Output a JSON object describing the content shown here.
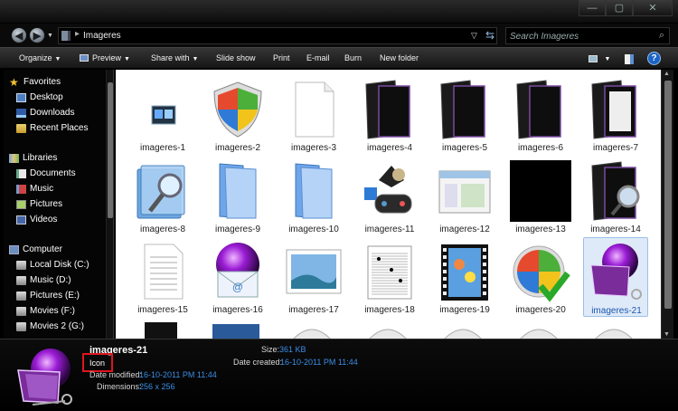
{
  "window": {
    "minimize": "—",
    "maximize": "▢",
    "close": "✕"
  },
  "address": {
    "folder": "Imageres",
    "separator": "▸",
    "search_placeholder": "Search Imageres"
  },
  "toolbar": {
    "organize": "Organize",
    "preview": "Preview",
    "share_with": "Share with",
    "slide_show": "Slide show",
    "print": "Print",
    "email": "E-mail",
    "burn": "Burn",
    "new_folder": "New folder",
    "help": "?"
  },
  "nav": {
    "favorites": {
      "label": "Favorites",
      "items": [
        "Desktop",
        "Downloads",
        "Recent Places"
      ]
    },
    "libraries": {
      "label": "Libraries",
      "items": [
        "Documents",
        "Music",
        "Pictures",
        "Videos"
      ]
    },
    "computer": {
      "label": "Computer",
      "items": [
        "Local Disk (C:)",
        "Music (D:)",
        "Pictures (E:)",
        "Movies (F:)",
        "Movies 2 (G:)"
      ]
    }
  },
  "files": [
    {
      "name": "imageres-1",
      "icon": "window-shot-icon"
    },
    {
      "name": "imageres-2",
      "icon": "shield-icon"
    },
    {
      "name": "imageres-3",
      "icon": "blank-page-icon"
    },
    {
      "name": "imageres-4",
      "icon": "dark-folder-icon"
    },
    {
      "name": "imageres-5",
      "icon": "dark-folder-icon"
    },
    {
      "name": "imageres-6",
      "icon": "dark-folder-icon"
    },
    {
      "name": "imageres-7",
      "icon": "dark-folder-page-icon"
    },
    {
      "name": "imageres-8",
      "icon": "search-folder-icon"
    },
    {
      "name": "imageres-9",
      "icon": "blue-folder-icon"
    },
    {
      "name": "imageres-10",
      "icon": "blue-folder-icon"
    },
    {
      "name": "imageres-11",
      "icon": "games-icon"
    },
    {
      "name": "imageres-12",
      "icon": "window-icon"
    },
    {
      "name": "imageres-13",
      "icon": "black-square-icon"
    },
    {
      "name": "imageres-14",
      "icon": "dark-folder-search-icon"
    },
    {
      "name": "imageres-15",
      "icon": "text-page-icon"
    },
    {
      "name": "imageres-16",
      "icon": "purple-mail-icon"
    },
    {
      "name": "imageres-17",
      "icon": "picture-icon"
    },
    {
      "name": "imageres-18",
      "icon": "music-sheet-icon"
    },
    {
      "name": "imageres-19",
      "icon": "film-strip-icon"
    },
    {
      "name": "imageres-20",
      "icon": "windows-check-icon"
    },
    {
      "name": "imageres-21",
      "icon": "purple-folder-icon"
    }
  ],
  "selected_index": 20,
  "details": {
    "name": "imageres-21",
    "type": "Icon",
    "size_label": "Size:",
    "size": "361 KB",
    "created_label": "Date created:",
    "created": "16-10-2011 PM 11:44",
    "modified_label": "Date modified:",
    "modified": "16-10-2011 PM 11:44",
    "dimensions_label": "Dimensions:",
    "dimensions": "256 x 256"
  }
}
